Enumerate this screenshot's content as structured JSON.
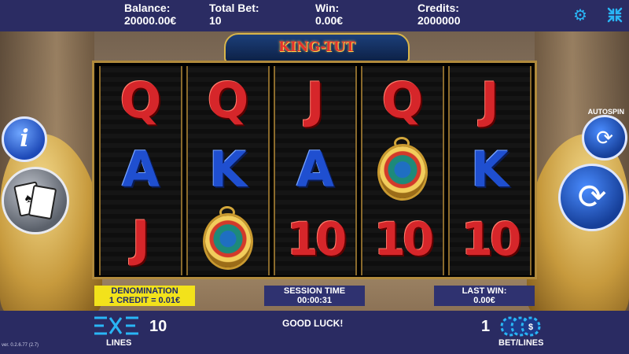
{
  "topbar": {
    "balance_label": "Balance:",
    "balance_value": "20000.00€",
    "total_bet_label": "Total Bet:",
    "total_bet_value": "10",
    "win_label": "Win:",
    "win_value": "0.00€",
    "credits_label": "Credits:",
    "credits_value": "2000000",
    "settings_icon": "gear-icon",
    "fullscreen_icon": "collapse-arrows-icon"
  },
  "logo": {
    "text": "KING-TUT"
  },
  "reels": [
    [
      "Q",
      "A",
      "J"
    ],
    [
      "Q",
      "K",
      "SCARAB"
    ],
    [
      "J",
      "A",
      "10"
    ],
    [
      "Q",
      "SCARAB",
      "10"
    ],
    [
      "J",
      "K",
      "10"
    ]
  ],
  "buttons": {
    "info_icon": "info-icon",
    "paytable_icon": "playing-cards-icon",
    "autospin_label": "AUTOSPIN",
    "autospin_icon": "autospin-arrows-icon",
    "spin_icon": "spin-arrows-icon"
  },
  "panels": {
    "denomination_label": "DENOMINATION",
    "denomination_value": "1 CREDIT = 0.01€",
    "session_label": "SESSION TIME",
    "session_value": "00:00:31",
    "lastwin_label": "LAST WIN:",
    "lastwin_value": "0.00€"
  },
  "bottombar": {
    "lines_value": "10",
    "lines_label": "LINES",
    "message": "GOOD LUCK!",
    "bet_value": "1",
    "bet_label": "BET/LINES",
    "version": "ver. 0.2.6.77 (2.7)"
  },
  "colors": {
    "bar": "#2a2b62",
    "accent": "#29b6f6",
    "denom_panel": "#f2e21b",
    "card_red": "#d6262a",
    "card_blue": "#1f4fd0"
  }
}
